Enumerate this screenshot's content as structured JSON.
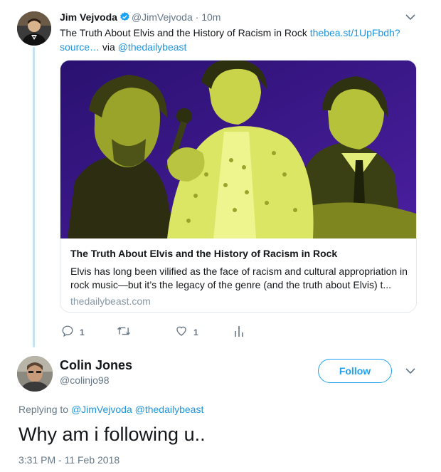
{
  "parent_tweet": {
    "name": "Jim Vejvoda",
    "handle": "@JimVejvoda",
    "separator": "·",
    "time": "10m",
    "text": "The Truth About Elvis and the History of Racism in Rock",
    "link_text": "thebea.st/1UpFbdh?source…",
    "via": "via",
    "mention": "@thedailybeast",
    "card": {
      "title": "The Truth About Elvis and the History of Racism in Rock",
      "description": "Elvis has long been vilified as the face of racism and cultural appropriation in rock music—but it’s the legacy of the genre (and the truth about Elvis) t...",
      "domain": "thedailybeast.com"
    },
    "actions": {
      "reply_count": "1",
      "retweet_count": "",
      "like_count": "1"
    }
  },
  "reply_tweet": {
    "name": "Colin Jones",
    "handle": "@colinjo98",
    "follow_label": "Follow",
    "replying_to_label": "Replying to",
    "replying_to": "@JimVejvoda @thedailybeast",
    "text": "Why am i following u..",
    "timestamp": "3:31 PM - 11 Feb 2018"
  },
  "colors": {
    "link": "#1b95e0",
    "muted": "#657786",
    "follow": "#1da1f2",
    "thread_line": "#c4e3f5",
    "card_bg_purple": "#3d1a8a",
    "card_tint": "#d8e64a"
  },
  "icons": [
    "verified-badge-icon",
    "chevron-down-icon",
    "reply-icon",
    "retweet-icon",
    "like-icon",
    "analytics-icon"
  ]
}
